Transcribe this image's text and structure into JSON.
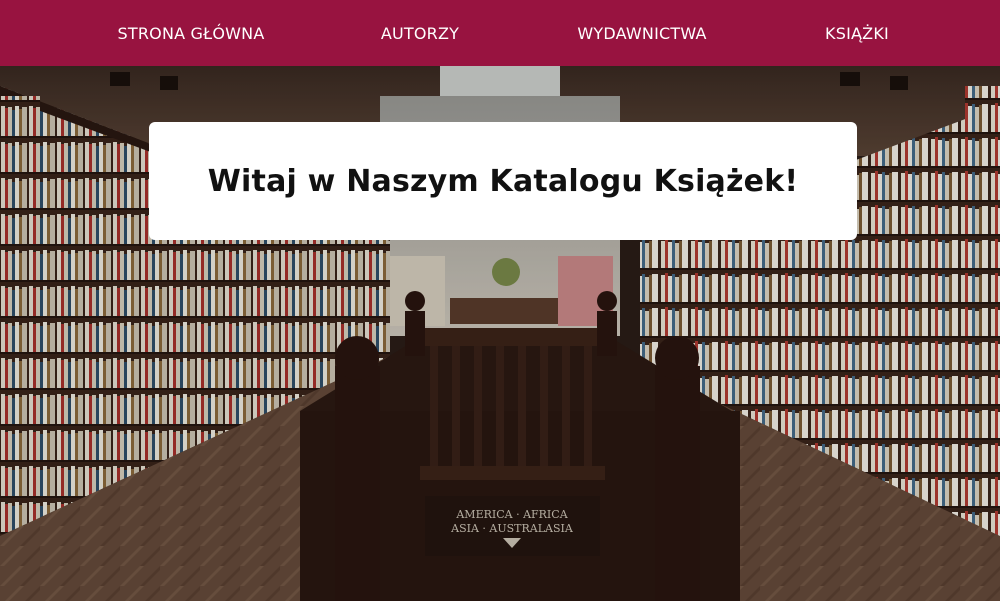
{
  "nav": {
    "home": "STRONA GŁÓWNA",
    "authors": "AUTORZY",
    "publishers": "WYDAWNICTWA",
    "books": "KSIĄŻKI"
  },
  "hero": {
    "title": "Witaj w Naszym Katalogu Książek!",
    "sign_line1": "AMERICA · AFRICA",
    "sign_line2": "ASIA · AUSTRALASIA"
  },
  "colors": {
    "navbar": "#981340",
    "nav_text": "#ffffff",
    "card": "#ffffff",
    "title_text": "#111111"
  }
}
